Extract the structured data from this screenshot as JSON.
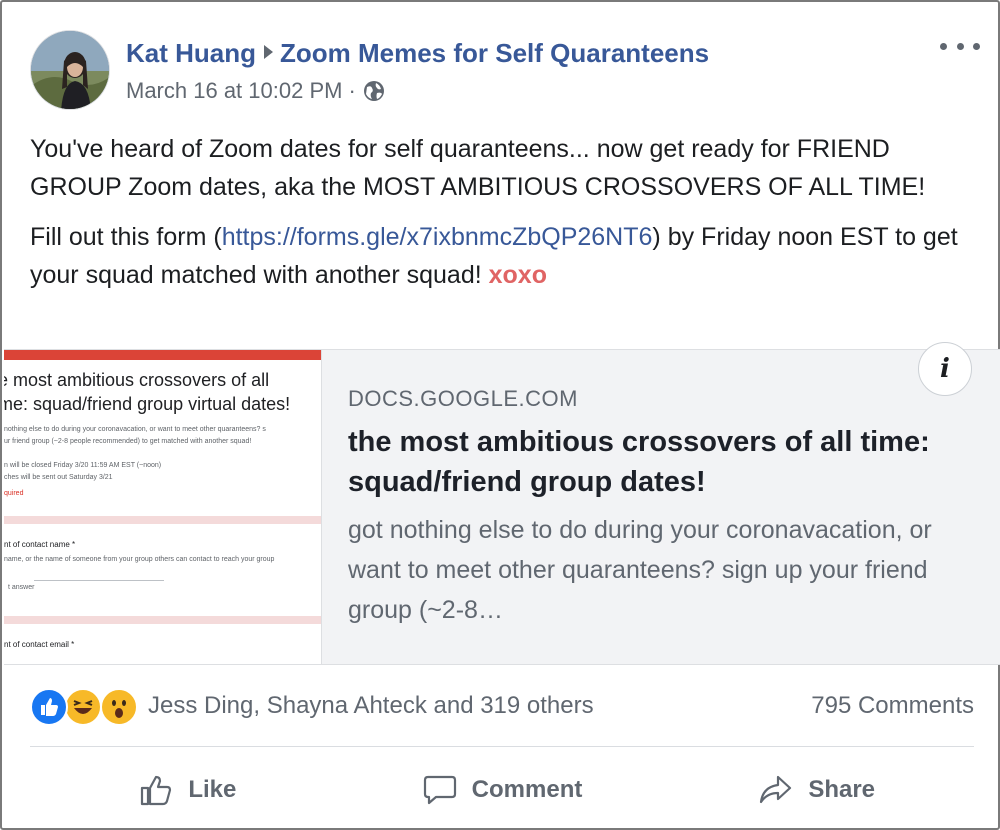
{
  "post": {
    "author": "Kat Huang",
    "group": "Zoom Memes for Self Quaranteens",
    "timestamp": "March 16 at 10:02 PM",
    "privacy_icon": "globe-icon",
    "more_icon": "ellipsis-icon",
    "body": {
      "p1": "You've heard of Zoom dates for self quaranteens... now get ready for FRIEND GROUP Zoom dates, aka the MOST AMBITIOUS CROSSOVERS OF ALL TIME!",
      "p2_before": "Fill out this form (",
      "p2_link": "https://forms.gle/x7ixbnmcZbQP26NT6",
      "p2_after": ") by Friday noon EST to get your squad matched with another squad! ",
      "p2_tag": "xoxo"
    }
  },
  "link_card": {
    "domain": "DOCS.GOOGLE.COM",
    "title": "the most ambitious crossovers of all time: squad/friend group dates!",
    "description": "got nothing else to do during your coronavacation, or want to meet other quaranteens? sign up your friend group (~2-8…",
    "info_label": "i",
    "thumbnail": {
      "title_line1": "e most ambitious crossovers of all",
      "title_line2": "me: squad/friend group virtual dates!",
      "text1": "nothing else to do during your coronavacation, or want to meet other quaranteens? s",
      "text2": "ur friend group (~2-8 people recommended) to get matched with another squad!",
      "text3": "n will be closed Friday 3/20 11:59 AM EST (~noon)",
      "text4": "ches will be sent out Saturday 3/21",
      "required": "quired",
      "q1_label": "nt of contact name *",
      "q1_help": "name, or the name of someone from your group others can contact to reach your group",
      "q1_answer": "t answer",
      "q2_label": "nt of contact email *"
    }
  },
  "reactions": {
    "icons": [
      "like-reaction-icon",
      "haha-reaction-icon",
      "wow-reaction-icon"
    ],
    "colors": {
      "like": "#1877f2",
      "haha": "#f7b928",
      "wow": "#f7b928"
    },
    "names": "Jess Ding, Shayna Ahteck and 319 others",
    "comments": "795 Comments"
  },
  "actions": {
    "like": "Like",
    "comment": "Comment",
    "share": "Share"
  },
  "colors": {
    "link": "#385898",
    "secondary_text": "#606770",
    "accent_red": "#e06464"
  }
}
